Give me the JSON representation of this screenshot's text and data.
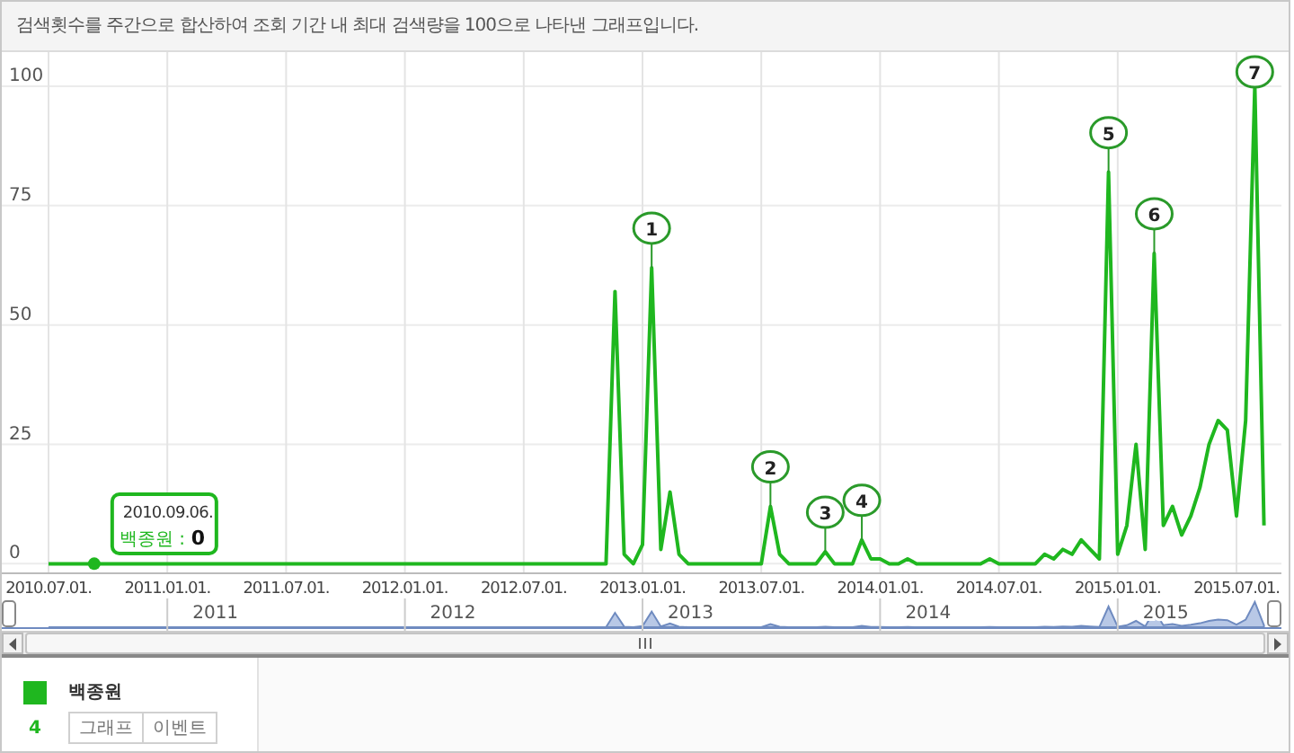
{
  "header": {
    "text": "검색횟수를 주간으로 합산하여 조회 기간 내 최대 검색량을 100으로 나타낸 그래프입니다."
  },
  "chart": {
    "chart_data": {
      "type": "line",
      "categories": [
        "2010.07.01.",
        null,
        null,
        null,
        null,
        null,
        null,
        null,
        null,
        null,
        null,
        null,
        null,
        "2011.01.01.",
        null,
        null,
        null,
        null,
        null,
        null,
        null,
        null,
        null,
        null,
        null,
        null,
        "2011.07.01.",
        null,
        null,
        null,
        null,
        null,
        null,
        null,
        null,
        null,
        null,
        null,
        null,
        "2012.01.01.",
        null,
        null,
        null,
        null,
        null,
        null,
        null,
        null,
        null,
        null,
        null,
        null,
        "2012.07.01.",
        null,
        null,
        null,
        null,
        null,
        null,
        null,
        null,
        null,
        null,
        null,
        null,
        "2013.01.01.",
        null,
        null,
        null,
        null,
        null,
        null,
        null,
        null,
        null,
        null,
        null,
        null,
        "2013.07.01.",
        null,
        null,
        null,
        null,
        null,
        null,
        null,
        null,
        null,
        null,
        null,
        null,
        "2014.01.01.",
        null,
        null,
        null,
        null,
        null,
        null,
        null,
        null,
        null,
        null,
        null,
        null,
        "2014.07.01.",
        null,
        null,
        null,
        null,
        null,
        null,
        null,
        null,
        null,
        null,
        null,
        null,
        "2015.01.01.",
        null,
        null,
        null,
        null,
        null,
        null,
        null,
        null,
        null,
        null,
        null,
        null,
        "2015.07.01.",
        null,
        null,
        null
      ],
      "series": [
        {
          "name": "백종원",
          "color": "#1fb71f",
          "values": [
            0,
            0,
            0,
            0,
            0,
            0,
            0,
            0,
            0,
            0,
            0,
            0,
            0,
            0,
            0,
            0,
            0,
            0,
            0,
            0,
            0,
            0,
            0,
            0,
            0,
            0,
            0,
            0,
            0,
            0,
            0,
            0,
            0,
            0,
            0,
            0,
            0,
            0,
            0,
            0,
            0,
            0,
            0,
            0,
            0,
            0,
            0,
            0,
            0,
            0,
            0,
            0,
            0,
            0,
            0,
            0,
            0,
            0,
            0,
            0,
            0,
            0,
            57,
            2,
            0,
            4,
            62,
            3,
            15,
            2,
            0,
            0,
            0,
            0,
            0,
            0,
            0,
            0,
            0,
            12,
            2,
            0,
            0,
            0,
            0,
            2.5,
            0,
            0,
            0,
            5,
            1,
            1,
            0,
            0,
            1,
            0,
            0,
            0,
            0,
            0,
            0,
            0,
            0,
            1,
            0,
            0,
            0,
            0,
            0,
            2,
            1,
            3,
            2,
            5,
            3,
            1,
            82,
            2,
            8,
            25,
            3,
            65,
            8,
            12,
            6,
            10,
            16,
            25,
            30,
            28,
            10,
            30,
            100,
            8
          ]
        }
      ],
      "ylim": [
        -2,
        100
      ],
      "grid": true,
      "yticks": [
        0,
        25,
        50,
        75,
        100
      ],
      "annotations": [
        {
          "text": "1",
          "y": 62
        },
        {
          "text": "2",
          "y": 12
        },
        {
          "text": "3",
          "y": 2.5
        },
        {
          "text": "4",
          "y": 5
        },
        {
          "text": "5",
          "y": 82
        },
        {
          "text": "6",
          "y": 65
        },
        {
          "text": "7",
          "y": 100
        }
      ]
    },
    "tooltip": {
      "date": "2010.09.06.",
      "label": "백종원 :",
      "value": "0"
    }
  },
  "navigator": {
    "year_labels": [
      "2011",
      "2012",
      "2013",
      "2014",
      "2015"
    ]
  },
  "legend": {
    "items": [
      {
        "count": "4",
        "buttons": [
          "그래프",
          "이벤트"
        ]
      }
    ]
  }
}
